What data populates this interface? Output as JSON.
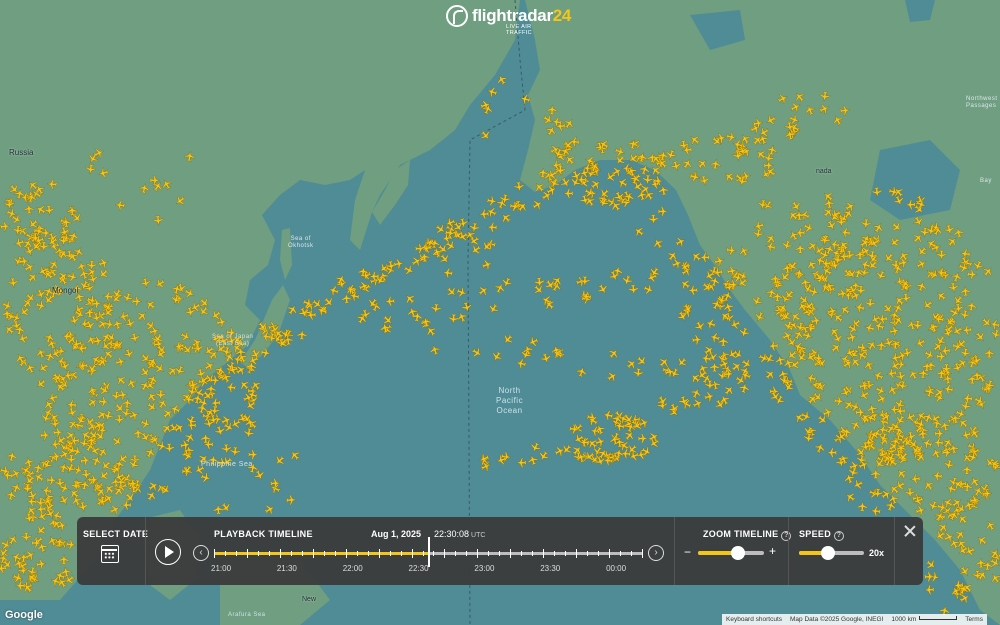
{
  "app": {
    "logo_word": "flightradar",
    "logo_number": "24",
    "logo_tagline": "LIVE AIR TRAFFIC"
  },
  "map": {
    "labels": {
      "russia": "Russia",
      "mongolia": "Mongol",
      "sea_okhotsk": "Sea of\nOkhotsk",
      "sea_japan": "Sea of Japan\n(East Sea)",
      "philippine_sea": "Philippine Sea",
      "north_pacific": "North\nPacific\nOcean",
      "canada": "nada",
      "northwest_passages": "Northwest\nPassages",
      "baffin_bay": "Bay",
      "arafura_sea": "Arafura Sea",
      "new_guinea": "New"
    },
    "colors": {
      "ocean": "#4f8c96",
      "land": "#6f9e80",
      "aircraft": "#f5c518",
      "aircraft_outline": "#7a5c00"
    }
  },
  "panel": {
    "select_date": {
      "title": "SELECT DATE",
      "icon": "calendar-icon"
    },
    "playback": {
      "title": "PLAYBACK TIMELINE",
      "date": "Aug 1, 2025",
      "time": "22:30:08",
      "timezone": "UTC",
      "play_icon": "play-icon",
      "prev_icon": "chevron-left-icon",
      "next_icon": "chevron-right-icon",
      "tick_labels": [
        "21:00",
        "21:30",
        "22:00",
        "22:30",
        "23:00",
        "23:30",
        "00:00"
      ],
      "progress": 0.505
    },
    "zoom": {
      "title": "ZOOM TIMELINE",
      "minus": "−",
      "plus": "+",
      "level": 0.6
    },
    "speed": {
      "title": "SPEED",
      "value": "20x",
      "level": 0.45
    },
    "close_icon": "close-icon"
  },
  "footer": {
    "google": "Google",
    "keyboard_shortcuts": "Keyboard shortcuts",
    "map_data": "Map Data ©2025 Google, INEGI",
    "scale": "1000 km",
    "terms": "Terms"
  }
}
